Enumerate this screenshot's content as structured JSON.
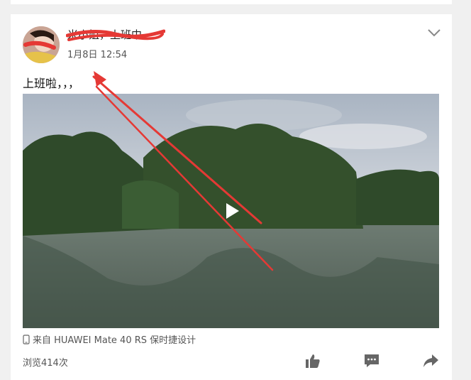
{
  "post": {
    "username": "米小姐，上班中",
    "timestamp": "1月8日 12:54",
    "text": "上班啦，，，",
    "device": "来自 HUAWEI Mate 40 RS 保时捷设计",
    "views": "浏览414次"
  },
  "icons": {
    "menu": "chevron-down-icon",
    "play": "play-icon",
    "device": "phone-icon",
    "like": "thumbs-up-icon",
    "comment": "comment-icon",
    "share": "share-icon"
  },
  "colors": {
    "annotation_red": "#e53935",
    "icon_gray": "#666666"
  }
}
